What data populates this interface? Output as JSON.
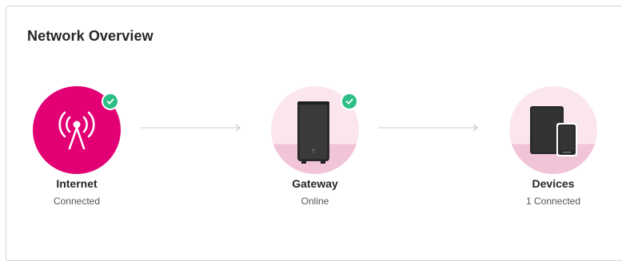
{
  "card": {
    "title": "Network Overview"
  },
  "nodes": [
    {
      "label": "Internet",
      "status": "Connected",
      "icon": "antenna-icon",
      "checked": true
    },
    {
      "label": "Gateway",
      "status": "Online",
      "icon": "gateway-router-icon",
      "checked": true
    },
    {
      "label": "Devices",
      "status": "1 Connected",
      "icon": "tablet-phone-icon",
      "checked": false
    }
  ],
  "colors": {
    "brand_magenta": "#e20074",
    "pink_light": "#fbe6ef",
    "pink_mid": "#f2c4d8",
    "success_green": "#2bbf86",
    "text_dark": "#262626",
    "text_gray": "#555555"
  }
}
